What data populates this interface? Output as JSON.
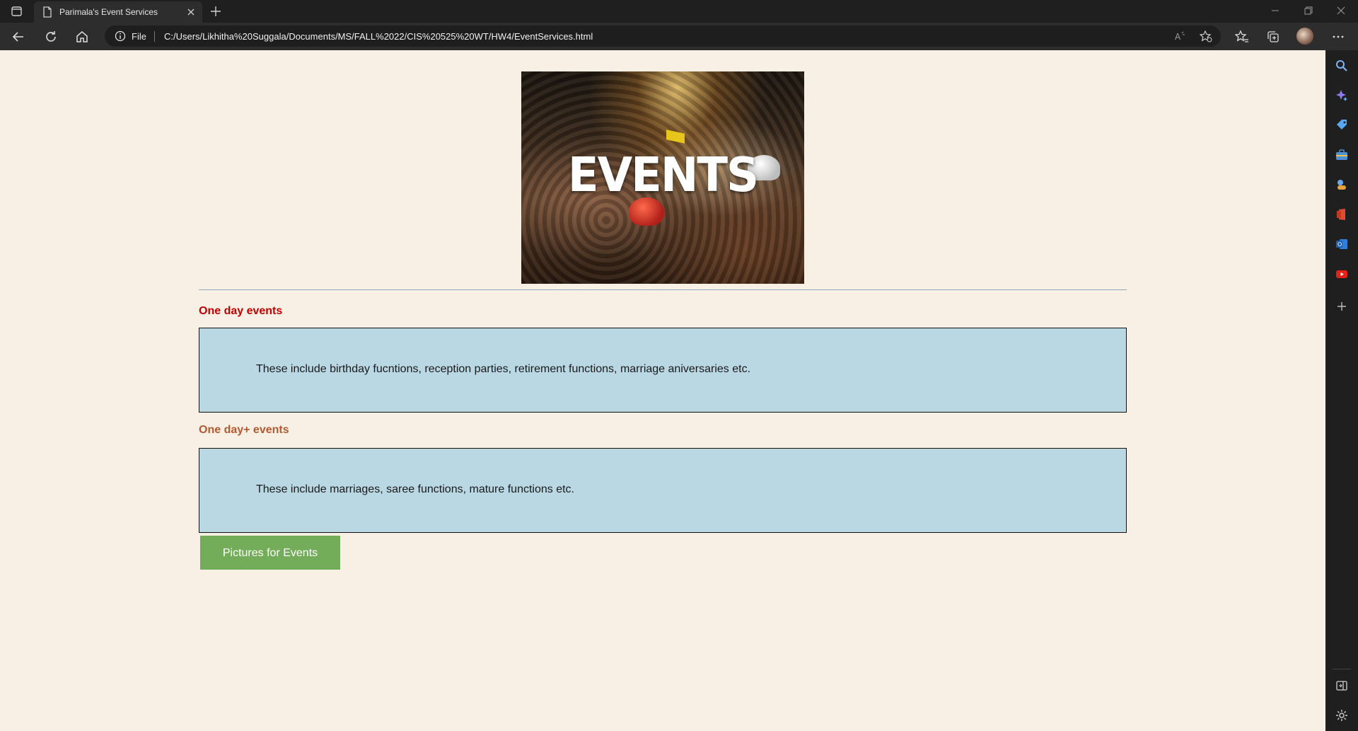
{
  "browser": {
    "tab_title": "Parimala's Event Services",
    "address_scheme": "File",
    "url": "C:/Users/Likhitha%20Suggala/Documents/MS/FALL%2022/CIS%20525%20WT/HW4/EventServices.html",
    "icons": {
      "tab_actions": "tab-actions-icon",
      "page": "page-icon",
      "close": "close-icon",
      "new_tab": "plus-icon",
      "back": "back-arrow-icon",
      "refresh": "refresh-icon",
      "home": "home-icon",
      "info": "info-icon",
      "read_aloud": "read-aloud-icon",
      "add_favorite": "star-plus-icon",
      "favorites": "favorites-icon",
      "collections": "collections-icon",
      "more": "more-icon"
    }
  },
  "sidebar": {
    "icons": [
      "search-icon",
      "copilot-icon",
      "shopping-tag-icon",
      "tools-icon",
      "games-icon",
      "office-icon",
      "outlook-icon",
      "youtube-icon",
      "add-icon",
      "sidebar-toggle-icon",
      "settings-icon"
    ]
  },
  "page": {
    "hero_word": "EVENTS",
    "sections": [
      {
        "title": "One day events",
        "title_color": "#c00000",
        "text": "These include birthday fucntions, reception parties, retirement functions, marriage aniversaries etc."
      },
      {
        "title": "One day+ events",
        "title_color": "#b45a32",
        "text": "These include marriages, saree functions, mature functions etc."
      }
    ],
    "button_label": "Pictures for Events",
    "colors": {
      "background": "#f8f0e4",
      "box": "#b9d8e4",
      "button": "#74ad59"
    }
  }
}
